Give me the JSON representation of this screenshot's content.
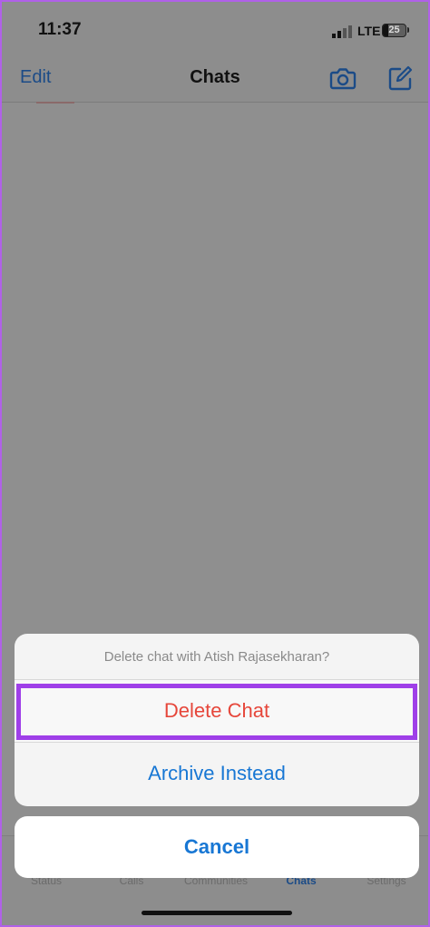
{
  "status_bar": {
    "time": "11:37",
    "network": "LTE",
    "battery_percent": "25",
    "battery_level": 0.25
  },
  "nav": {
    "edit_label": "Edit",
    "title": "Chats",
    "camera_icon": "camera-icon",
    "compose_icon": "compose-icon"
  },
  "action_sheet": {
    "header": "Delete chat with Atish Rajasekharan?",
    "delete_label": "Delete Chat",
    "archive_label": "Archive Instead",
    "cancel_label": "Cancel"
  },
  "tabs": [
    {
      "label": "Status",
      "active": false
    },
    {
      "label": "Calls",
      "active": false
    },
    {
      "label": "Communities",
      "active": false
    },
    {
      "label": "Chats",
      "active": true
    },
    {
      "label": "Settings",
      "active": false
    }
  ],
  "colors": {
    "destructive": "#e6463a",
    "accent": "#1877d4",
    "highlight": "#9f3fe8"
  }
}
